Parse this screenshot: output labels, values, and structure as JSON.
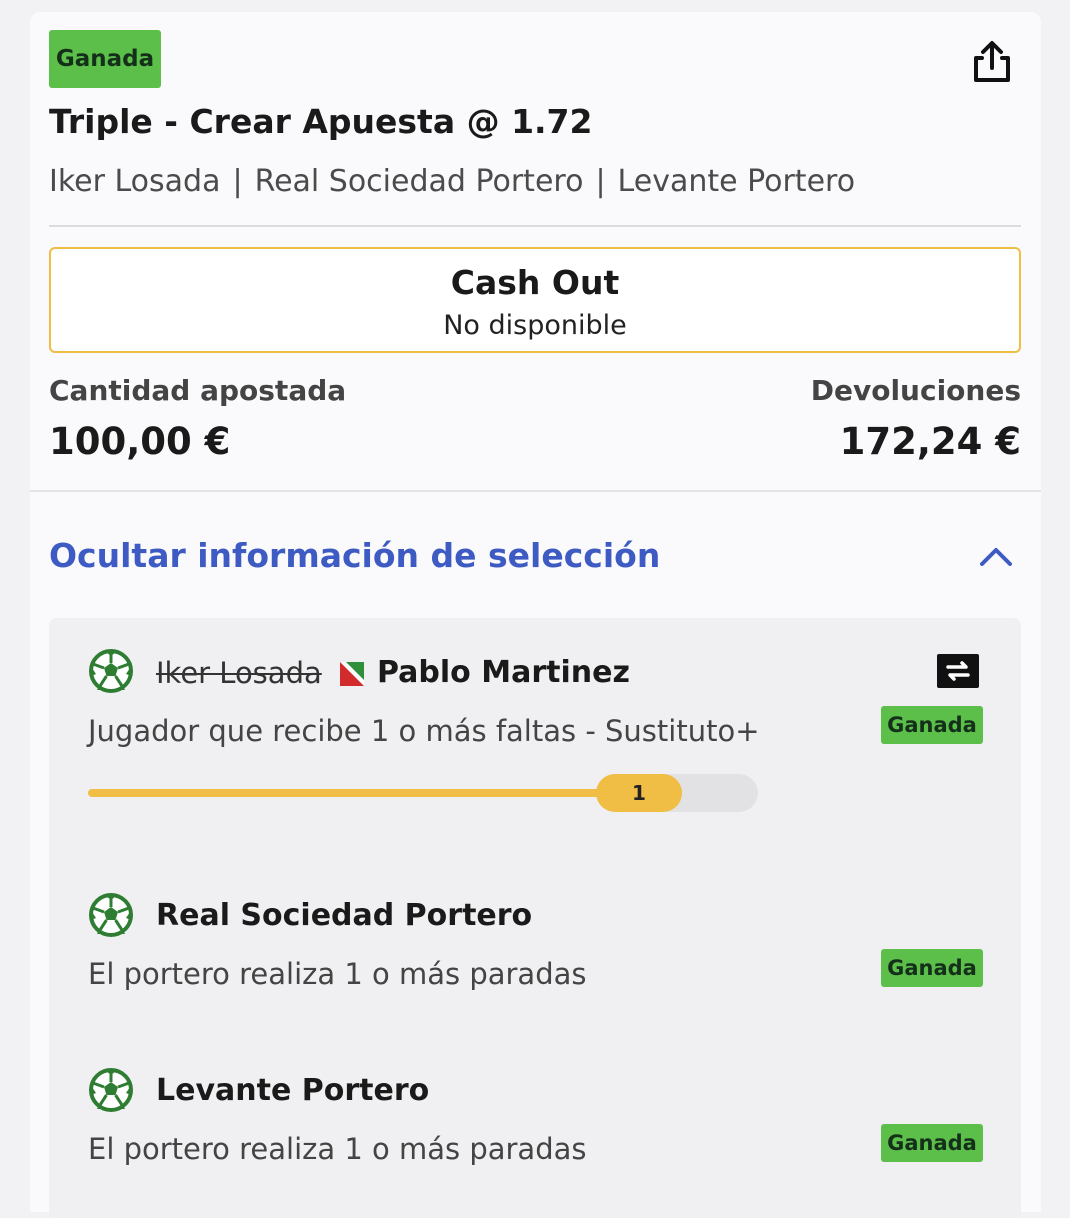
{
  "bet": {
    "status": "Ganada",
    "title": "Triple - Crear Apuesta @ 1.72",
    "legs_summary": [
      "Iker Losada",
      "Real Sociedad Portero",
      "Levante Portero"
    ],
    "separator": "|"
  },
  "cashout": {
    "title": "Cash Out",
    "subtitle": "No disponible"
  },
  "stake": {
    "label": "Cantidad apostada",
    "value": "100,00 €"
  },
  "returns": {
    "label": "Devoluciones",
    "value": "172,24 €"
  },
  "toggle": {
    "label": "Ocultar información de selección"
  },
  "selections": [
    {
      "original_player": "Iker Losada",
      "name": "Pablo Martinez",
      "market": "Jugador que recibe 1 o más faltas - Sustituto+",
      "status": "Ganada",
      "progress": {
        "value": "1",
        "fraction": 0.87
      }
    },
    {
      "name": "Real Sociedad Portero",
      "market": "El portero realiza 1 o más paradas",
      "status": "Ganada"
    },
    {
      "name": "Levante Portero",
      "market": "El portero realiza 1 o más paradas",
      "status": "Ganada"
    }
  ],
  "icons": {
    "share": "share-icon",
    "chevron": "chevron-up-icon",
    "ball": "soccer-ball-icon",
    "substitution": "substitution-icon",
    "flag": "team-flag-icon"
  },
  "colors": {
    "won_green": "#5cbf4a",
    "cashout_border": "#f0bd45",
    "link_blue": "#3d5bc2",
    "progress_yellow": "#f0bd45"
  }
}
